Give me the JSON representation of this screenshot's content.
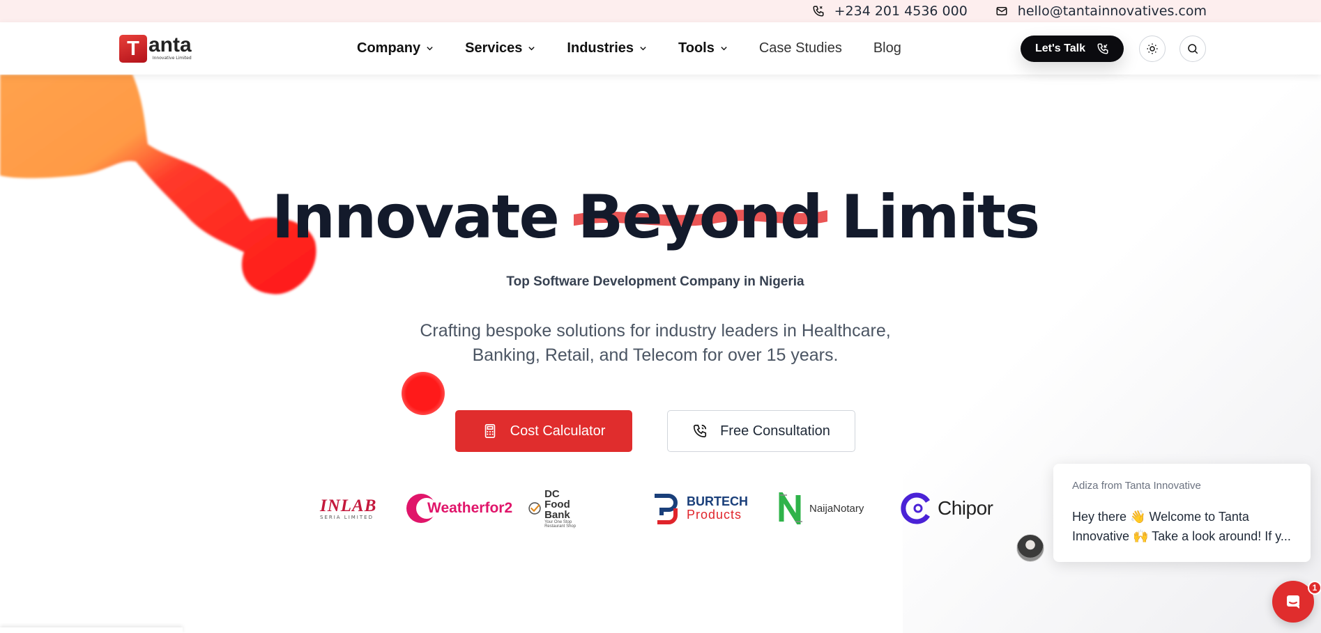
{
  "topbar": {
    "phone": "+234 201 4536 000",
    "email": "hello@tantainnovatives.com"
  },
  "brand": {
    "mark": "T",
    "word": "anta",
    "tagline": "Innovative Limited"
  },
  "nav": {
    "items": [
      {
        "label": "Company",
        "dropdown": true
      },
      {
        "label": "Services",
        "dropdown": true
      },
      {
        "label": "Industries",
        "dropdown": true
      },
      {
        "label": "Tools",
        "dropdown": true
      },
      {
        "label": "Case Studies",
        "dropdown": false
      },
      {
        "label": "Blog",
        "dropdown": false
      }
    ],
    "cta_label": "Let's Talk",
    "theme_icon": "sun-icon",
    "search_icon": "search-icon"
  },
  "hero": {
    "title_start": "Innovate ",
    "title_strike": "Beyond",
    "title_end": " Limits",
    "subtitle": "Top Software Development Company in Nigeria",
    "description": "Crafting bespoke solutions for industry leaders in Healthcare, Banking, Retail, and Telecom for over 15 years.",
    "primary_cta": "Cost Calculator",
    "secondary_cta": "Free Consultation"
  },
  "clients": {
    "inlab": {
      "name": "INLAB",
      "sub": "SERIA LIMITED"
    },
    "weather": {
      "name": "Weatherfor2"
    },
    "dcfood": {
      "name": "DC Food Bank",
      "sub": "Your One Stop Restaurant Shop"
    },
    "burtech": {
      "line1": "BURTECH",
      "line2": "Products"
    },
    "naija": {
      "name": "NaijaNotary"
    },
    "chipor": {
      "name": "Chipor"
    }
  },
  "chat": {
    "from": "Adiza from Tanta Innovative",
    "message": "Hey there 👋 Welcome to Tanta Innovative 🙌 Take a look around! If y...",
    "badge_count": "1"
  },
  "colors": {
    "accent": "#e02d2d",
    "dark": "#131a2b",
    "topbar_bg": "#fdeeee"
  }
}
